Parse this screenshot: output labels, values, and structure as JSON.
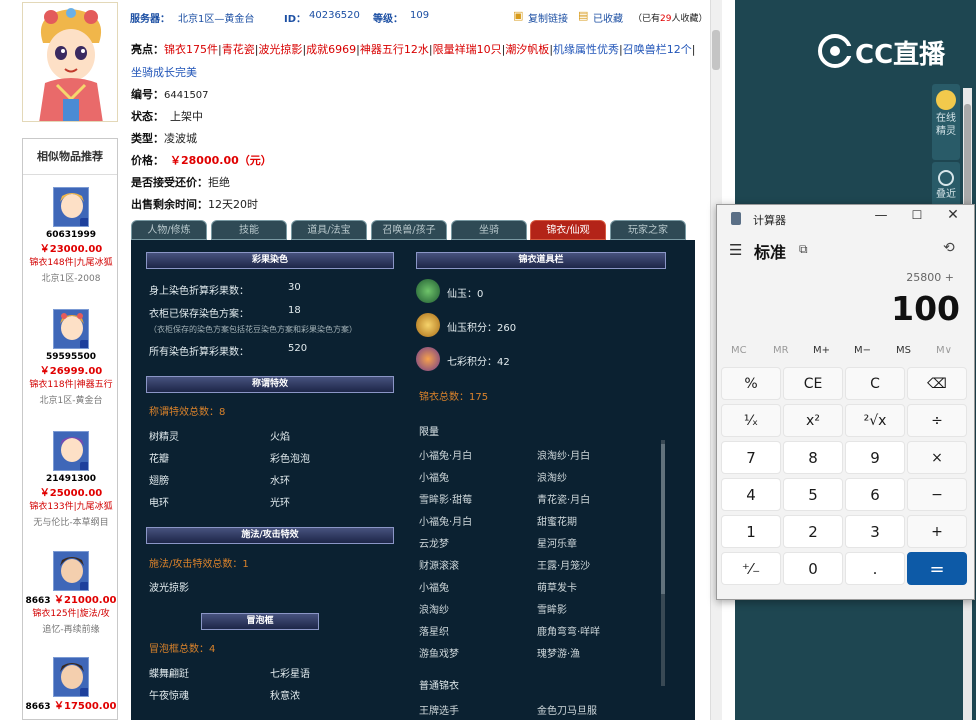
{
  "topbar": {
    "server_label": "服务器：",
    "server_value": "北京1区—黄金台",
    "id_label": "ID：",
    "id_value": "40236520",
    "level_label": "等级：",
    "level_value": "109",
    "copy_link": "复制链接",
    "favorited": "已收藏",
    "fav_prefix": "（已有",
    "fav_count": "29",
    "fav_suffix": "人收藏）"
  },
  "details": {
    "highlights_label": "亮点：",
    "highlights": [
      {
        "text": "锦衣175件",
        "color": "red"
      },
      {
        "text": "青花瓷",
        "color": "red"
      },
      {
        "text": "波光掠影",
        "color": "red"
      },
      {
        "text": "成就6969",
        "color": "red"
      },
      {
        "text": "神器五行12水",
        "color": "red"
      },
      {
        "text": "限量祥瑞10只",
        "color": "red"
      },
      {
        "text": "潮汐帆板",
        "color": "red"
      },
      {
        "text": "机缘属性优秀",
        "color": "blue"
      },
      {
        "text": "召唤兽栏12个",
        "color": "blue"
      }
    ],
    "highlight_line2": "坐骑成长完美",
    "serial_label": "编号：",
    "serial_value": "6441507",
    "status_label": "状态：",
    "status_value": "上架中",
    "type_label": "类型：",
    "type_value": "凌波城",
    "price_label": "价格：",
    "price_value": "￥28000.00（元）",
    "bargain_label": "是否接受还价：",
    "bargain_value": "拒绝",
    "remaining_label": "出售剩余时间：",
    "remaining_value": "12天20时"
  },
  "sidebar": {
    "title": "相似物品推荐",
    "items": [
      {
        "id": "60631999",
        "price": "￥23000.00",
        "desc": "锦衣148件|九尾冰狐",
        "server": "北京1区-2008"
      },
      {
        "id": "59595500",
        "price": "￥26999.00",
        "desc": "锦衣118件|神器五行",
        "server": "北京1区-黄金台"
      },
      {
        "id": "21491300",
        "price": "￥25000.00",
        "desc": "锦衣133件|九尾冰狐",
        "server": "无与伦比-本草纲目"
      },
      {
        "id": "8663",
        "price": "￥21000.00",
        "desc": "锦衣125件|旋法/攻",
        "server": "追忆-再续前缘"
      },
      {
        "id": "8663",
        "price": "￥17500.00",
        "desc": "",
        "server": ""
      }
    ]
  },
  "tabs": [
    "人物/修炼",
    "技能",
    "道具/法宝",
    "召唤兽/孩子",
    "坐骑",
    "锦衣/仙观",
    "玩家之家"
  ],
  "active_tab": "锦衣/仙观",
  "panel": {
    "dye": {
      "heading": "彩果染色",
      "row1_label": "身上染色折算彩果数：",
      "row1_value": "30",
      "row2_label": "衣柜已保存染色方案：",
      "row2_value": "18",
      "note": "（衣柜保存的染色方案包括花豆染色方案和彩果染色方案）",
      "row3_label": "所有染色折算彩果数：",
      "row3_value": "520"
    },
    "title_effect": {
      "heading": "称谓特效",
      "total": "称谓特效总数：8",
      "items": [
        "树精灵",
        "火焰",
        "花瓣",
        "彩色泡泡",
        "翅膀",
        "水环",
        "电环",
        "光环"
      ]
    },
    "spell_effect": {
      "heading": "施法/攻击特效",
      "total": "施法/攻击特效总数：1",
      "items": [
        "波光掠影"
      ]
    },
    "bubble": {
      "heading": "冒泡框",
      "total": "冒泡框总数：4",
      "items": [
        "蝶舞翩跹",
        "七彩星语",
        "午夜惊魂",
        "秋意浓"
      ]
    },
    "jinyi": {
      "heading": "锦衣道具栏",
      "xianyu": "仙玉：0",
      "xianyu_points": "仙玉积分：260",
      "qicai_points": "七彩积分：42",
      "total": "锦衣总数：175",
      "limited_label": "限量",
      "limited": [
        "小福兔·月白",
        "浪淘纱·月白",
        "小福兔",
        "浪淘纱",
        "雪眸影·甜莓",
        "青花瓷·月白",
        "小福兔·月白",
        "甜蜜花期",
        "云龙梦",
        "星河乐章",
        "财源滚滚",
        "王露·月笼沙",
        "小福兔",
        "萌草发卡",
        "浪淘纱",
        "雪眸影",
        "落星织",
        "鹿角弯弯·咩咩",
        "游鱼戏梦",
        "瑰梦游·渔"
      ],
      "normal_label": "普通锦衣",
      "normal": [
        "王牌选手",
        "金色刀马旦服"
      ]
    }
  },
  "cc": {
    "logo": "CC直播",
    "online_label": "在线精灵",
    "dup_label": "叠近"
  },
  "calculator": {
    "title": "计算器",
    "mode": "标准",
    "expression": "25800 +",
    "display": "100",
    "memory": [
      "MC",
      "MR",
      "M+",
      "M−",
      "MS",
      "M∨"
    ],
    "keys": [
      "%",
      "CE",
      "C",
      "⌫",
      "¹⁄ₓ",
      "x²",
      "²√x",
      "÷",
      "7",
      "8",
      "9",
      "×",
      "4",
      "5",
      "6",
      "−",
      "1",
      "2",
      "3",
      "+",
      "⁺⁄₋",
      "0",
      ".",
      "="
    ]
  }
}
